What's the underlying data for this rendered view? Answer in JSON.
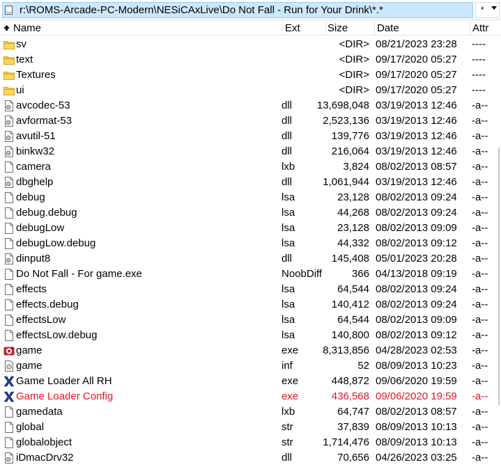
{
  "path_bar": {
    "path": "r:\\ROMS-Arcade-PC-Modern\\NESiCAxLive\\Do Not Fall - Run for Your Drink\\*.*",
    "filter_label": "*"
  },
  "columns": {
    "name": "Name",
    "ext": "Ext",
    "size": "Size",
    "date": "Date",
    "attr": "Attr"
  },
  "sort": {
    "column": "name",
    "direction": "ascending"
  },
  "files": [
    {
      "name": "sv",
      "ext": "",
      "size": "<DIR>",
      "date": "08/21/2023 23:28",
      "attr": "----",
      "icon": "folder-icon"
    },
    {
      "name": "text",
      "ext": "",
      "size": "<DIR>",
      "date": "09/17/2020 05:27",
      "attr": "----",
      "icon": "folder-icon"
    },
    {
      "name": "Textures",
      "ext": "",
      "size": "<DIR>",
      "date": "09/17/2020 05:27",
      "attr": "----",
      "icon": "folder-icon"
    },
    {
      "name": "ui",
      "ext": "",
      "size": "<DIR>",
      "date": "09/17/2020 05:27",
      "attr": "----",
      "icon": "folder-icon"
    },
    {
      "name": "avcodec-53",
      "ext": "dll",
      "size": "13,698,048",
      "date": "03/19/2013 12:46",
      "attr": "-a--",
      "icon": "dll-icon"
    },
    {
      "name": "avformat-53",
      "ext": "dll",
      "size": "2,523,136",
      "date": "03/19/2013 12:46",
      "attr": "-a--",
      "icon": "dll-icon"
    },
    {
      "name": "avutil-51",
      "ext": "dll",
      "size": "139,776",
      "date": "03/19/2013 12:46",
      "attr": "-a--",
      "icon": "dll-icon"
    },
    {
      "name": "binkw32",
      "ext": "dll",
      "size": "216,064",
      "date": "03/19/2013 12:46",
      "attr": "-a--",
      "icon": "dll-icon"
    },
    {
      "name": "camera",
      "ext": "lxb",
      "size": "3,824",
      "date": "08/02/2013 08:57",
      "attr": "-a--",
      "icon": "file-icon"
    },
    {
      "name": "dbghelp",
      "ext": "dll",
      "size": "1,061,944",
      "date": "03/19/2013 12:46",
      "attr": "-a--",
      "icon": "dll-icon"
    },
    {
      "name": "debug",
      "ext": "lsa",
      "size": "23,128",
      "date": "08/02/2013 09:24",
      "attr": "-a--",
      "icon": "file-icon"
    },
    {
      "name": "debug.debug",
      "ext": "lsa",
      "size": "44,268",
      "date": "08/02/2013 09:24",
      "attr": "-a--",
      "icon": "file-icon"
    },
    {
      "name": "debugLow",
      "ext": "lsa",
      "size": "23,128",
      "date": "08/02/2013 09:09",
      "attr": "-a--",
      "icon": "file-icon"
    },
    {
      "name": "debugLow.debug",
      "ext": "lsa",
      "size": "44,332",
      "date": "08/02/2013 09:12",
      "attr": "-a--",
      "icon": "file-icon"
    },
    {
      "name": "dinput8",
      "ext": "dll",
      "size": "145,408",
      "date": "05/01/2023 20:28",
      "attr": "-a--",
      "icon": "dll-icon"
    },
    {
      "name": "Do Not Fall - For game.exe",
      "ext": "NoobDiff",
      "size": "366",
      "date": "04/13/2018 09:19",
      "attr": "-a--",
      "icon": "file-icon"
    },
    {
      "name": "effects",
      "ext": "lsa",
      "size": "64,544",
      "date": "08/02/2013 09:24",
      "attr": "-a--",
      "icon": "file-icon"
    },
    {
      "name": "effects.debug",
      "ext": "lsa",
      "size": "140,412",
      "date": "08/02/2013 09:24",
      "attr": "-a--",
      "icon": "file-icon"
    },
    {
      "name": "effectsLow",
      "ext": "lsa",
      "size": "64,544",
      "date": "08/02/2013 09:09",
      "attr": "-a--",
      "icon": "file-icon"
    },
    {
      "name": "effectsLow.debug",
      "ext": "lsa",
      "size": "140,800",
      "date": "08/02/2013 09:12",
      "attr": "-a--",
      "icon": "file-icon"
    },
    {
      "name": "game",
      "ext": "exe",
      "size": "8,313,856",
      "date": "04/28/2023 02:53",
      "attr": "-a--",
      "icon": "game-exe-icon"
    },
    {
      "name": "game",
      "ext": "inf",
      "size": "52",
      "date": "08/09/2013 10:23",
      "attr": "-a--",
      "icon": "inf-icon"
    },
    {
      "name": "Game Loader All RH",
      "ext": "exe",
      "size": "448,872",
      "date": "09/06/2020 19:59",
      "attr": "-a--",
      "icon": "x-app-icon"
    },
    {
      "name": "Game Loader Config",
      "ext": "exe",
      "size": "436,568",
      "date": "09/06/2020 19:59",
      "attr": "-a--",
      "icon": "x-app-icon",
      "highlight": "red"
    },
    {
      "name": "gamedata",
      "ext": "lxb",
      "size": "64,747",
      "date": "08/02/2013 08:57",
      "attr": "-a--",
      "icon": "file-icon"
    },
    {
      "name": "global",
      "ext": "str",
      "size": "37,839",
      "date": "08/09/2013 10:13",
      "attr": "-a--",
      "icon": "file-icon"
    },
    {
      "name": "globalobject",
      "ext": "str",
      "size": "1,714,476",
      "date": "08/09/2013 10:13",
      "attr": "-a--",
      "icon": "file-icon"
    },
    {
      "name": "iDmacDrv32",
      "ext": "dll",
      "size": "70,656",
      "date": "04/26/2023 03:25",
      "attr": "-a--",
      "icon": "dll-icon"
    }
  ],
  "colors": {
    "path_bg": "#cce8ff",
    "folder": "#f8c93a",
    "highlight_red": "#e81123",
    "x_app_blue": "#1c3f8f"
  }
}
